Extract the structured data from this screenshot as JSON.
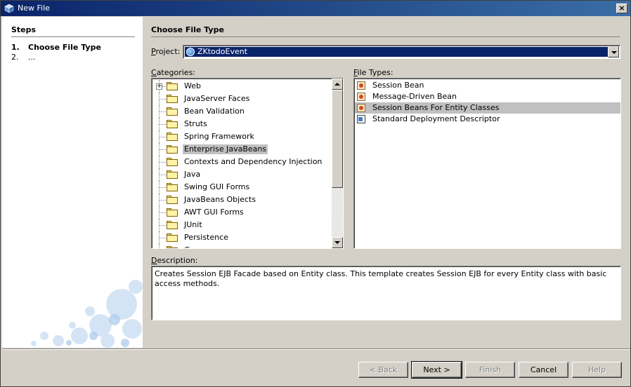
{
  "window": {
    "title": "New File",
    "close_label": "×"
  },
  "steps": {
    "header": "Steps",
    "items": [
      {
        "num": "1.",
        "label": "Choose File Type"
      },
      {
        "num": "2.",
        "label": "..."
      }
    ]
  },
  "main": {
    "header": "Choose File Type",
    "project_label_prefix": "P",
    "project_label_rest": "roject:",
    "project_value": "ZKtodoEvent",
    "categories_label_prefix": "C",
    "categories_label_rest": "ategories:",
    "filetypes_label_prefix": "F",
    "filetypes_label_rest": "ile Types:",
    "categories": [
      {
        "label": "Web",
        "expander": "+"
      },
      {
        "label": "JavaServer Faces"
      },
      {
        "label": "Bean Validation"
      },
      {
        "label": "Struts"
      },
      {
        "label": "Spring Framework"
      },
      {
        "label": "Enterprise JavaBeans",
        "selected": true
      },
      {
        "label": "Contexts and Dependency Injection"
      },
      {
        "label": "Java"
      },
      {
        "label": "Swing GUI Forms"
      },
      {
        "label": "JavaBeans Objects"
      },
      {
        "label": "AWT GUI Forms"
      },
      {
        "label": "JUnit"
      },
      {
        "label": "Persistence"
      },
      {
        "label": "G"
      }
    ],
    "file_types": [
      {
        "label": "Session Bean",
        "icon": "session-bean-icon"
      },
      {
        "label": "Message-Driven Bean",
        "icon": "message-bean-icon"
      },
      {
        "label": "Session Beans For Entity Classes",
        "icon": "entity-session-bean-icon",
        "selected": true
      },
      {
        "label": "Standard Deployment Descriptor",
        "icon": "deployment-descriptor-icon"
      }
    ],
    "description_label_prefix": "D",
    "description_label_rest": "escription:",
    "description": "Creates Session EJB Facade based on Entity class. This template creates Session EJB for every Entity class with basic access methods."
  },
  "buttons": {
    "back": "< Back",
    "next": "Next >",
    "finish": "Finish",
    "cancel": "Cancel",
    "help": "Help"
  }
}
